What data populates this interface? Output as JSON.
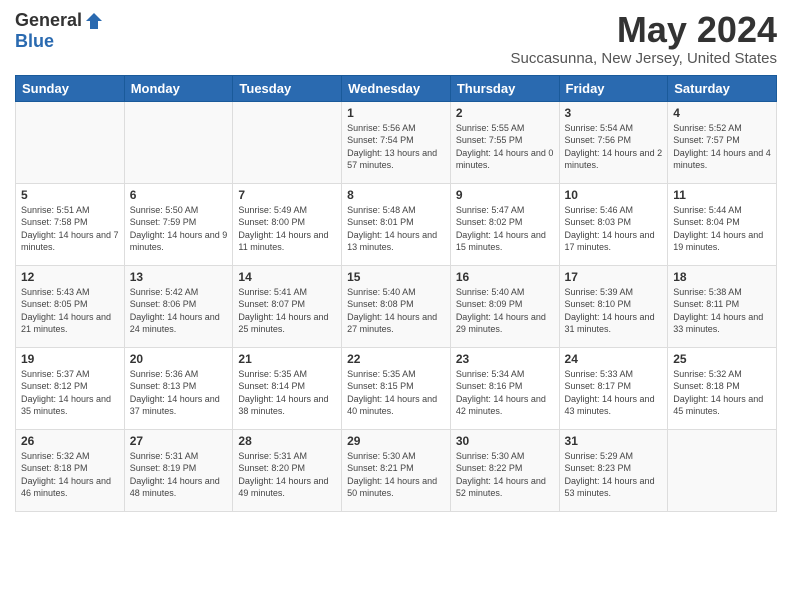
{
  "logo": {
    "general": "General",
    "blue": "Blue"
  },
  "header": {
    "month": "May 2024",
    "location": "Succasunna, New Jersey, United States"
  },
  "weekdays": [
    "Sunday",
    "Monday",
    "Tuesday",
    "Wednesday",
    "Thursday",
    "Friday",
    "Saturday"
  ],
  "weeks": [
    [
      {
        "day": "",
        "info": ""
      },
      {
        "day": "",
        "info": ""
      },
      {
        "day": "",
        "info": ""
      },
      {
        "day": "1",
        "info": "Sunrise: 5:56 AM\nSunset: 7:54 PM\nDaylight: 13 hours and 57 minutes."
      },
      {
        "day": "2",
        "info": "Sunrise: 5:55 AM\nSunset: 7:55 PM\nDaylight: 14 hours and 0 minutes."
      },
      {
        "day": "3",
        "info": "Sunrise: 5:54 AM\nSunset: 7:56 PM\nDaylight: 14 hours and 2 minutes."
      },
      {
        "day": "4",
        "info": "Sunrise: 5:52 AM\nSunset: 7:57 PM\nDaylight: 14 hours and 4 minutes."
      }
    ],
    [
      {
        "day": "5",
        "info": "Sunrise: 5:51 AM\nSunset: 7:58 PM\nDaylight: 14 hours and 7 minutes."
      },
      {
        "day": "6",
        "info": "Sunrise: 5:50 AM\nSunset: 7:59 PM\nDaylight: 14 hours and 9 minutes."
      },
      {
        "day": "7",
        "info": "Sunrise: 5:49 AM\nSunset: 8:00 PM\nDaylight: 14 hours and 11 minutes."
      },
      {
        "day": "8",
        "info": "Sunrise: 5:48 AM\nSunset: 8:01 PM\nDaylight: 14 hours and 13 minutes."
      },
      {
        "day": "9",
        "info": "Sunrise: 5:47 AM\nSunset: 8:02 PM\nDaylight: 14 hours and 15 minutes."
      },
      {
        "day": "10",
        "info": "Sunrise: 5:46 AM\nSunset: 8:03 PM\nDaylight: 14 hours and 17 minutes."
      },
      {
        "day": "11",
        "info": "Sunrise: 5:44 AM\nSunset: 8:04 PM\nDaylight: 14 hours and 19 minutes."
      }
    ],
    [
      {
        "day": "12",
        "info": "Sunrise: 5:43 AM\nSunset: 8:05 PM\nDaylight: 14 hours and 21 minutes."
      },
      {
        "day": "13",
        "info": "Sunrise: 5:42 AM\nSunset: 8:06 PM\nDaylight: 14 hours and 24 minutes."
      },
      {
        "day": "14",
        "info": "Sunrise: 5:41 AM\nSunset: 8:07 PM\nDaylight: 14 hours and 25 minutes."
      },
      {
        "day": "15",
        "info": "Sunrise: 5:40 AM\nSunset: 8:08 PM\nDaylight: 14 hours and 27 minutes."
      },
      {
        "day": "16",
        "info": "Sunrise: 5:40 AM\nSunset: 8:09 PM\nDaylight: 14 hours and 29 minutes."
      },
      {
        "day": "17",
        "info": "Sunrise: 5:39 AM\nSunset: 8:10 PM\nDaylight: 14 hours and 31 minutes."
      },
      {
        "day": "18",
        "info": "Sunrise: 5:38 AM\nSunset: 8:11 PM\nDaylight: 14 hours and 33 minutes."
      }
    ],
    [
      {
        "day": "19",
        "info": "Sunrise: 5:37 AM\nSunset: 8:12 PM\nDaylight: 14 hours and 35 minutes."
      },
      {
        "day": "20",
        "info": "Sunrise: 5:36 AM\nSunset: 8:13 PM\nDaylight: 14 hours and 37 minutes."
      },
      {
        "day": "21",
        "info": "Sunrise: 5:35 AM\nSunset: 8:14 PM\nDaylight: 14 hours and 38 minutes."
      },
      {
        "day": "22",
        "info": "Sunrise: 5:35 AM\nSunset: 8:15 PM\nDaylight: 14 hours and 40 minutes."
      },
      {
        "day": "23",
        "info": "Sunrise: 5:34 AM\nSunset: 8:16 PM\nDaylight: 14 hours and 42 minutes."
      },
      {
        "day": "24",
        "info": "Sunrise: 5:33 AM\nSunset: 8:17 PM\nDaylight: 14 hours and 43 minutes."
      },
      {
        "day": "25",
        "info": "Sunrise: 5:32 AM\nSunset: 8:18 PM\nDaylight: 14 hours and 45 minutes."
      }
    ],
    [
      {
        "day": "26",
        "info": "Sunrise: 5:32 AM\nSunset: 8:18 PM\nDaylight: 14 hours and 46 minutes."
      },
      {
        "day": "27",
        "info": "Sunrise: 5:31 AM\nSunset: 8:19 PM\nDaylight: 14 hours and 48 minutes."
      },
      {
        "day": "28",
        "info": "Sunrise: 5:31 AM\nSunset: 8:20 PM\nDaylight: 14 hours and 49 minutes."
      },
      {
        "day": "29",
        "info": "Sunrise: 5:30 AM\nSunset: 8:21 PM\nDaylight: 14 hours and 50 minutes."
      },
      {
        "day": "30",
        "info": "Sunrise: 5:30 AM\nSunset: 8:22 PM\nDaylight: 14 hours and 52 minutes."
      },
      {
        "day": "31",
        "info": "Sunrise: 5:29 AM\nSunset: 8:23 PM\nDaylight: 14 hours and 53 minutes."
      },
      {
        "day": "",
        "info": ""
      }
    ]
  ]
}
